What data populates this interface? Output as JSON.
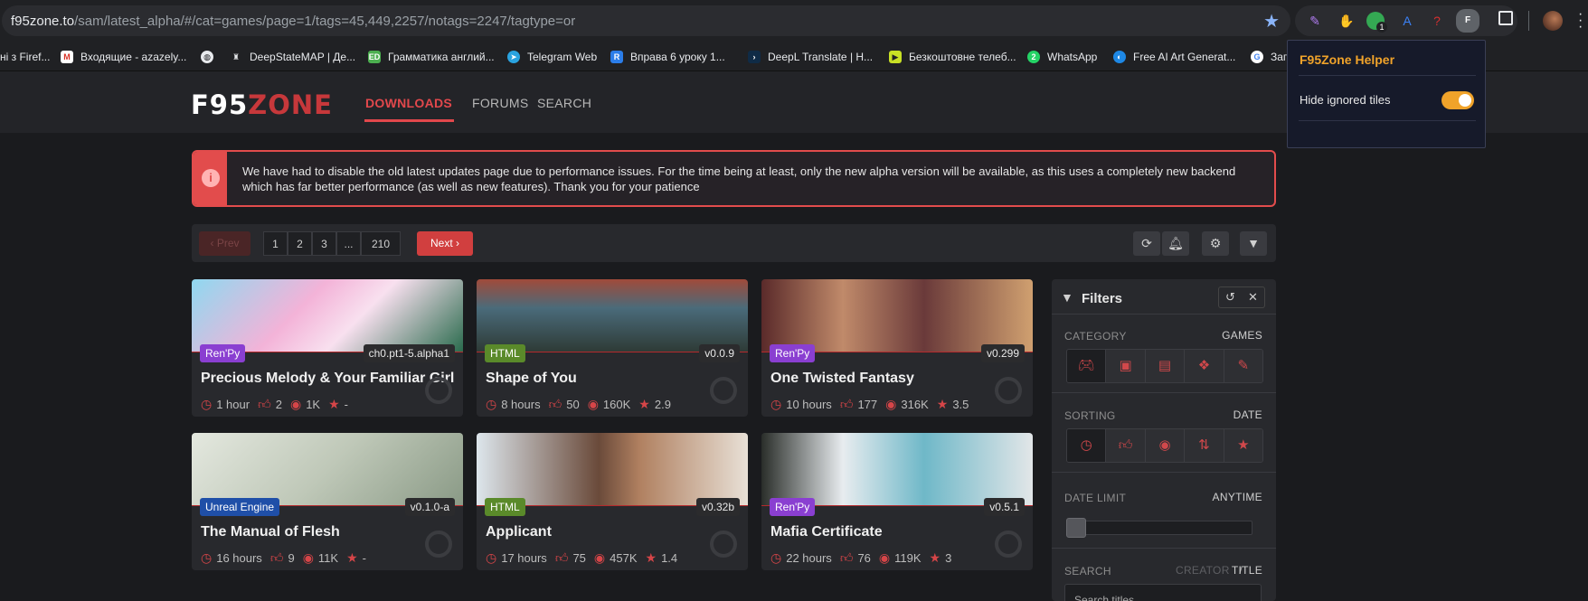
{
  "browser": {
    "url_host": "f95zone.to",
    "url_path": "/sam/latest_alpha/#/cat=games/page=1/tags=45,449,2257/notags=2247/tagtype=or",
    "extension_badge": "1",
    "extension_letter": "F"
  },
  "bookmarks": [
    {
      "label": "ні з Firef...",
      "icon": "folder-icon"
    },
    {
      "label": "Входящие - azazely...",
      "icon": "gmail-icon"
    },
    {
      "label": "",
      "icon": "globe-icon"
    },
    {
      "label": "DeepStateMAP | Де...",
      "icon": "map-icon"
    },
    {
      "label": "Грамматика англий...",
      "icon": "ed-icon"
    },
    {
      "label": "Telegram Web",
      "icon": "telegram-icon"
    },
    {
      "label": "Вправа 6 уроку 1...",
      "icon": "exercise-icon"
    },
    {
      "label": "DeepL Translate | Н...",
      "icon": "deepl-icon"
    },
    {
      "label": "Безкоштовне телеб...",
      "icon": "tv-icon"
    },
    {
      "label": "WhatsApp",
      "icon": "whatsapp-icon"
    },
    {
      "label": "Free AI Art Generat...",
      "icon": "ai-icon"
    },
    {
      "label": "Заг",
      "icon": "google-icon"
    }
  ],
  "site": {
    "logo_f95": "F95",
    "logo_zone": "ZONE",
    "nav": [
      "DOWNLOADS",
      "FORUMS",
      "SEARCH"
    ]
  },
  "alert": {
    "icon": "i",
    "text": "We have had to disable the old latest updates page due to performance issues. For the time being at least, only the new alpha version will be available, as this uses a completely new backend which has far better performance (as well as new features). Thank you for your patience"
  },
  "pagination": {
    "prev": "‹ Prev",
    "pages": [
      "1",
      "2",
      "3",
      "...",
      "210"
    ],
    "next": "Next ›"
  },
  "tiles": [
    {
      "engine": "Ren'Py",
      "engine_color": "#8a3fd1",
      "version": "ch0.pt1-5.alpha1",
      "title": "Precious Melody & Your Familiar Girl",
      "time": "1 hour",
      "likes": "2",
      "views": "1K",
      "rating": "-"
    },
    {
      "engine": "HTML",
      "engine_color": "#5a8a2a",
      "version": "v0.0.9",
      "title": "Shape of You",
      "time": "8 hours",
      "likes": "50",
      "views": "160K",
      "rating": "2.9"
    },
    {
      "engine": "Ren'Py",
      "engine_color": "#8a3fd1",
      "version": "v0.299",
      "title": "One Twisted Fantasy",
      "time": "10 hours",
      "likes": "177",
      "views": "316K",
      "rating": "3.5"
    },
    {
      "engine": "Unreal Engine",
      "engine_color": "#1f4fa8",
      "version": "v0.1.0-a",
      "title": "The Manual of Flesh",
      "time": "16 hours",
      "likes": "9",
      "views": "11K",
      "rating": "-"
    },
    {
      "engine": "HTML",
      "engine_color": "#5a8a2a",
      "version": "v0.32b",
      "title": "Applicant",
      "time": "17 hours",
      "likes": "75",
      "views": "457K",
      "rating": "1.4"
    },
    {
      "engine": "Ren'Py",
      "engine_color": "#8a3fd1",
      "version": "v0.5.1",
      "title": "Mafia Certificate",
      "time": "22 hours",
      "likes": "76",
      "views": "119K",
      "rating": "3"
    }
  ],
  "filters": {
    "title": "Filters",
    "category_label": "CATEGORY",
    "category_value": "GAMES",
    "sorting_label": "SORTING",
    "sorting_value": "DATE",
    "date_limit_label": "DATE LIMIT",
    "date_limit_value": "ANYTIME",
    "search_label": "SEARCH",
    "search_mode_creator": "CREATOR",
    "search_mode_sep": "/",
    "search_mode_title": "TITLE",
    "search_placeholder": "Search titles"
  },
  "popup": {
    "title": "F95Zone Helper",
    "toggle_label": "Hide ignored tiles",
    "toggle_on": true
  },
  "colors": {
    "accent": "#e2484c",
    "popup_accent": "#f0a32a"
  }
}
